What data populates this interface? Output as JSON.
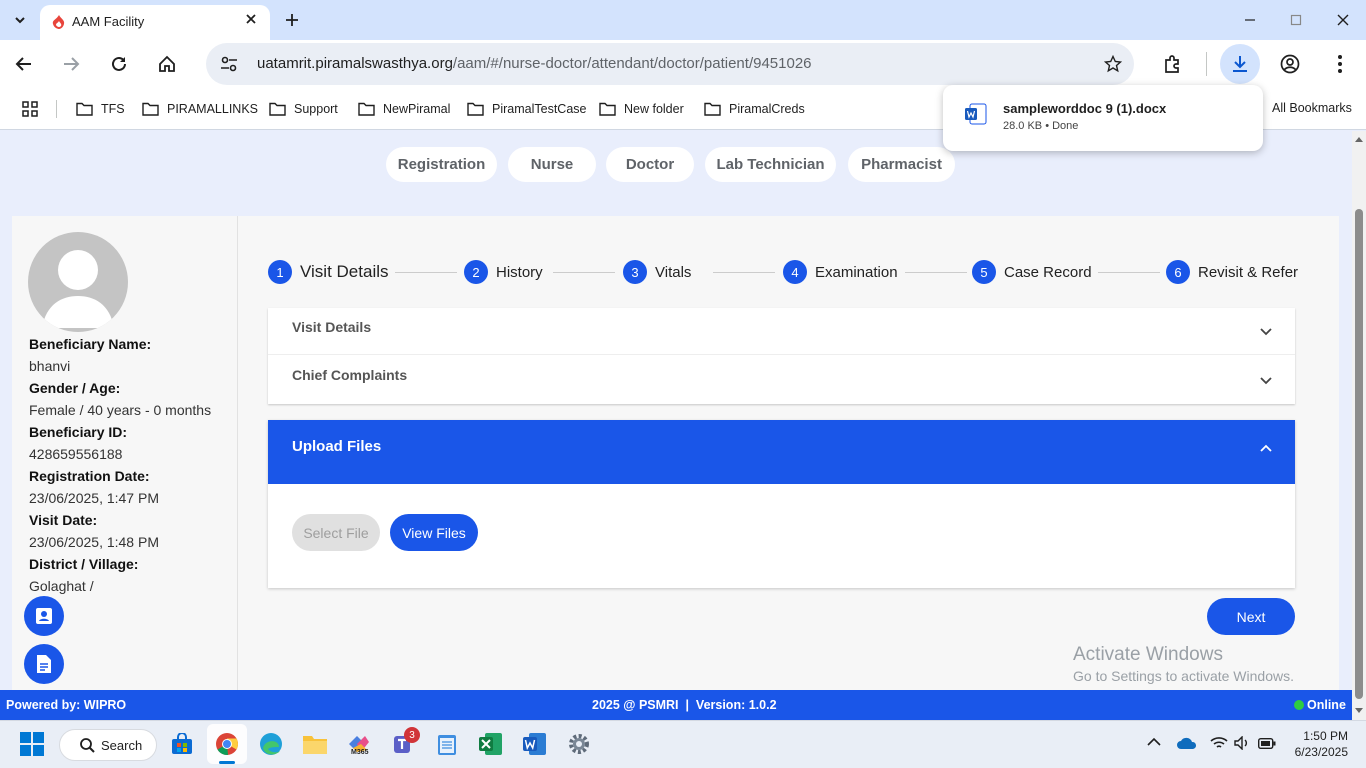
{
  "browser": {
    "tab_title": "AAM Facility",
    "url_domain": "uatamrit.piramalswasthya.org",
    "url_path": "/aam/#/nurse-doctor/attendant/doctor/patient/9451026",
    "bookmarks": [
      "TFS",
      "PIRAMALLINKS",
      "Support",
      "NewPiramal",
      "PiramalTestCase",
      "New folder",
      "PiramalCreds"
    ],
    "all_bookmarks": "All Bookmarks",
    "download": {
      "filename": "sampleworddoc 9 (1).docx",
      "status": "28.0 KB • Done"
    }
  },
  "roles": [
    "Registration",
    "Nurse",
    "Doctor",
    "Lab Technician",
    "Pharmacist"
  ],
  "beneficiary": {
    "name_label": "Beneficiary Name:",
    "name": "bhanvi",
    "gender_label": "Gender / Age:",
    "gender": "Female / 40 years - 0 months",
    "id_label": "Beneficiary ID:",
    "id": "428659556188",
    "reg_label": "Registration Date:",
    "reg": "23/06/2025, 1:47 PM",
    "visit_label": "Visit Date:",
    "visit": "23/06/2025, 1:48 PM",
    "district_label": "District / Village:",
    "district": "Golaghat /"
  },
  "steps": [
    {
      "n": "1",
      "label": "Visit Details"
    },
    {
      "n": "2",
      "label": "History"
    },
    {
      "n": "3",
      "label": "Vitals"
    },
    {
      "n": "4",
      "label": "Examination"
    },
    {
      "n": "5",
      "label": "Case Record"
    },
    {
      "n": "6",
      "label": "Revisit & Refer"
    }
  ],
  "panels": {
    "visit_details": "Visit Details",
    "chief_complaints": "Chief Complaints",
    "upload_files": "Upload Files",
    "select_file": "Select File",
    "view_files": "View Files",
    "next": "Next"
  },
  "watermark": {
    "line1": "Activate Windows",
    "line2": "Go to Settings to activate Windows."
  },
  "footer": {
    "left": "Powered by: WIPRO",
    "center": "2025 @ PSMRI  |  Version: 1.0.2",
    "right": "Online"
  },
  "taskbar": {
    "search": "Search",
    "time": "1:50 PM",
    "date": "6/23/2025",
    "teams_badge": "3",
    "m365": "M365"
  }
}
